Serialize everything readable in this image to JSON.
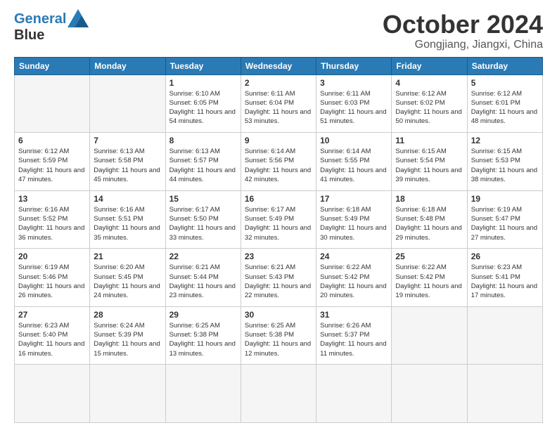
{
  "header": {
    "logo_line1": "General",
    "logo_line2": "Blue",
    "month": "October 2024",
    "location": "Gongjiang, Jiangxi, China"
  },
  "weekdays": [
    "Sunday",
    "Monday",
    "Tuesday",
    "Wednesday",
    "Thursday",
    "Friday",
    "Saturday"
  ],
  "days": [
    {
      "num": "",
      "sunrise": "",
      "sunset": "",
      "daylight": ""
    },
    {
      "num": "",
      "sunrise": "",
      "sunset": "",
      "daylight": ""
    },
    {
      "num": "1",
      "sunrise": "Sunrise: 6:10 AM",
      "sunset": "Sunset: 6:05 PM",
      "daylight": "Daylight: 11 hours and 54 minutes."
    },
    {
      "num": "2",
      "sunrise": "Sunrise: 6:11 AM",
      "sunset": "Sunset: 6:04 PM",
      "daylight": "Daylight: 11 hours and 53 minutes."
    },
    {
      "num": "3",
      "sunrise": "Sunrise: 6:11 AM",
      "sunset": "Sunset: 6:03 PM",
      "daylight": "Daylight: 11 hours and 51 minutes."
    },
    {
      "num": "4",
      "sunrise": "Sunrise: 6:12 AM",
      "sunset": "Sunset: 6:02 PM",
      "daylight": "Daylight: 11 hours and 50 minutes."
    },
    {
      "num": "5",
      "sunrise": "Sunrise: 6:12 AM",
      "sunset": "Sunset: 6:01 PM",
      "daylight": "Daylight: 11 hours and 48 minutes."
    },
    {
      "num": "6",
      "sunrise": "Sunrise: 6:12 AM",
      "sunset": "Sunset: 5:59 PM",
      "daylight": "Daylight: 11 hours and 47 minutes."
    },
    {
      "num": "7",
      "sunrise": "Sunrise: 6:13 AM",
      "sunset": "Sunset: 5:58 PM",
      "daylight": "Daylight: 11 hours and 45 minutes."
    },
    {
      "num": "8",
      "sunrise": "Sunrise: 6:13 AM",
      "sunset": "Sunset: 5:57 PM",
      "daylight": "Daylight: 11 hours and 44 minutes."
    },
    {
      "num": "9",
      "sunrise": "Sunrise: 6:14 AM",
      "sunset": "Sunset: 5:56 PM",
      "daylight": "Daylight: 11 hours and 42 minutes."
    },
    {
      "num": "10",
      "sunrise": "Sunrise: 6:14 AM",
      "sunset": "Sunset: 5:55 PM",
      "daylight": "Daylight: 11 hours and 41 minutes."
    },
    {
      "num": "11",
      "sunrise": "Sunrise: 6:15 AM",
      "sunset": "Sunset: 5:54 PM",
      "daylight": "Daylight: 11 hours and 39 minutes."
    },
    {
      "num": "12",
      "sunrise": "Sunrise: 6:15 AM",
      "sunset": "Sunset: 5:53 PM",
      "daylight": "Daylight: 11 hours and 38 minutes."
    },
    {
      "num": "13",
      "sunrise": "Sunrise: 6:16 AM",
      "sunset": "Sunset: 5:52 PM",
      "daylight": "Daylight: 11 hours and 36 minutes."
    },
    {
      "num": "14",
      "sunrise": "Sunrise: 6:16 AM",
      "sunset": "Sunset: 5:51 PM",
      "daylight": "Daylight: 11 hours and 35 minutes."
    },
    {
      "num": "15",
      "sunrise": "Sunrise: 6:17 AM",
      "sunset": "Sunset: 5:50 PM",
      "daylight": "Daylight: 11 hours and 33 minutes."
    },
    {
      "num": "16",
      "sunrise": "Sunrise: 6:17 AM",
      "sunset": "Sunset: 5:49 PM",
      "daylight": "Daylight: 11 hours and 32 minutes."
    },
    {
      "num": "17",
      "sunrise": "Sunrise: 6:18 AM",
      "sunset": "Sunset: 5:49 PM",
      "daylight": "Daylight: 11 hours and 30 minutes."
    },
    {
      "num": "18",
      "sunrise": "Sunrise: 6:18 AM",
      "sunset": "Sunset: 5:48 PM",
      "daylight": "Daylight: 11 hours and 29 minutes."
    },
    {
      "num": "19",
      "sunrise": "Sunrise: 6:19 AM",
      "sunset": "Sunset: 5:47 PM",
      "daylight": "Daylight: 11 hours and 27 minutes."
    },
    {
      "num": "20",
      "sunrise": "Sunrise: 6:19 AM",
      "sunset": "Sunset: 5:46 PM",
      "daylight": "Daylight: 11 hours and 26 minutes."
    },
    {
      "num": "21",
      "sunrise": "Sunrise: 6:20 AM",
      "sunset": "Sunset: 5:45 PM",
      "daylight": "Daylight: 11 hours and 24 minutes."
    },
    {
      "num": "22",
      "sunrise": "Sunrise: 6:21 AM",
      "sunset": "Sunset: 5:44 PM",
      "daylight": "Daylight: 11 hours and 23 minutes."
    },
    {
      "num": "23",
      "sunrise": "Sunrise: 6:21 AM",
      "sunset": "Sunset: 5:43 PM",
      "daylight": "Daylight: 11 hours and 22 minutes."
    },
    {
      "num": "24",
      "sunrise": "Sunrise: 6:22 AM",
      "sunset": "Sunset: 5:42 PM",
      "daylight": "Daylight: 11 hours and 20 minutes."
    },
    {
      "num": "25",
      "sunrise": "Sunrise: 6:22 AM",
      "sunset": "Sunset: 5:42 PM",
      "daylight": "Daylight: 11 hours and 19 minutes."
    },
    {
      "num": "26",
      "sunrise": "Sunrise: 6:23 AM",
      "sunset": "Sunset: 5:41 PM",
      "daylight": "Daylight: 11 hours and 17 minutes."
    },
    {
      "num": "27",
      "sunrise": "Sunrise: 6:23 AM",
      "sunset": "Sunset: 5:40 PM",
      "daylight": "Daylight: 11 hours and 16 minutes."
    },
    {
      "num": "28",
      "sunrise": "Sunrise: 6:24 AM",
      "sunset": "Sunset: 5:39 PM",
      "daylight": "Daylight: 11 hours and 15 minutes."
    },
    {
      "num": "29",
      "sunrise": "Sunrise: 6:25 AM",
      "sunset": "Sunset: 5:38 PM",
      "daylight": "Daylight: 11 hours and 13 minutes."
    },
    {
      "num": "30",
      "sunrise": "Sunrise: 6:25 AM",
      "sunset": "Sunset: 5:38 PM",
      "daylight": "Daylight: 11 hours and 12 minutes."
    },
    {
      "num": "31",
      "sunrise": "Sunrise: 6:26 AM",
      "sunset": "Sunset: 5:37 PM",
      "daylight": "Daylight: 11 hours and 11 minutes."
    },
    {
      "num": "",
      "sunrise": "",
      "sunset": "",
      "daylight": ""
    },
    {
      "num": "",
      "sunrise": "",
      "sunset": "",
      "daylight": ""
    },
    {
      "num": "",
      "sunrise": "",
      "sunset": "",
      "daylight": ""
    }
  ]
}
